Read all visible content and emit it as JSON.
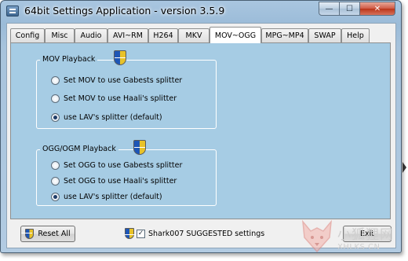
{
  "window": {
    "title": "64bit Settings Application - version 3.5.9",
    "minimize_glyph": "—",
    "maximize_glyph": "☐",
    "close_glyph": "✕"
  },
  "tabs": [
    {
      "label": "Config",
      "active": false
    },
    {
      "label": "Misc",
      "active": false
    },
    {
      "label": "Audio",
      "active": false
    },
    {
      "label": "AVI~RM",
      "active": false
    },
    {
      "label": "H264",
      "active": false
    },
    {
      "label": "MKV",
      "active": false
    },
    {
      "label": "MOV~OGG",
      "active": true
    },
    {
      "label": "MPG~MP4",
      "active": false
    },
    {
      "label": "SWAP",
      "active": false
    },
    {
      "label": "Help",
      "active": false
    }
  ],
  "mov_group": {
    "title": "MOV Playback",
    "options": [
      {
        "label": "Set MOV to use Gabests splitter",
        "checked": false
      },
      {
        "label": "Set MOV to use Haali's splitter",
        "checked": false
      },
      {
        "label": "use LAV's splitter (default)",
        "checked": true
      }
    ]
  },
  "ogg_group": {
    "title": "OGG/OGM Playback",
    "options": [
      {
        "label": "Set OGG to use Gabests splitter",
        "checked": false
      },
      {
        "label": "Set OGG to use Haali's splitter",
        "checked": false
      },
      {
        "label": "use LAV's splitter (default)",
        "checked": true
      }
    ]
  },
  "footer": {
    "reset_label": "Reset All",
    "suggested_label": "Shark007 SUGGESTED settings",
    "suggested_checked": true,
    "exit_label": "Exit"
  },
  "watermark": {
    "text_cn": "小狐狸网",
    "text_url": "XHLKS.CN"
  },
  "icons": {
    "app": "app-window-icon",
    "uac": "uac-shield-icon"
  },
  "colors": {
    "panel_bg": "#a6cce4",
    "titlebar": "#9bbbd8",
    "close_button": "#c8452a"
  }
}
